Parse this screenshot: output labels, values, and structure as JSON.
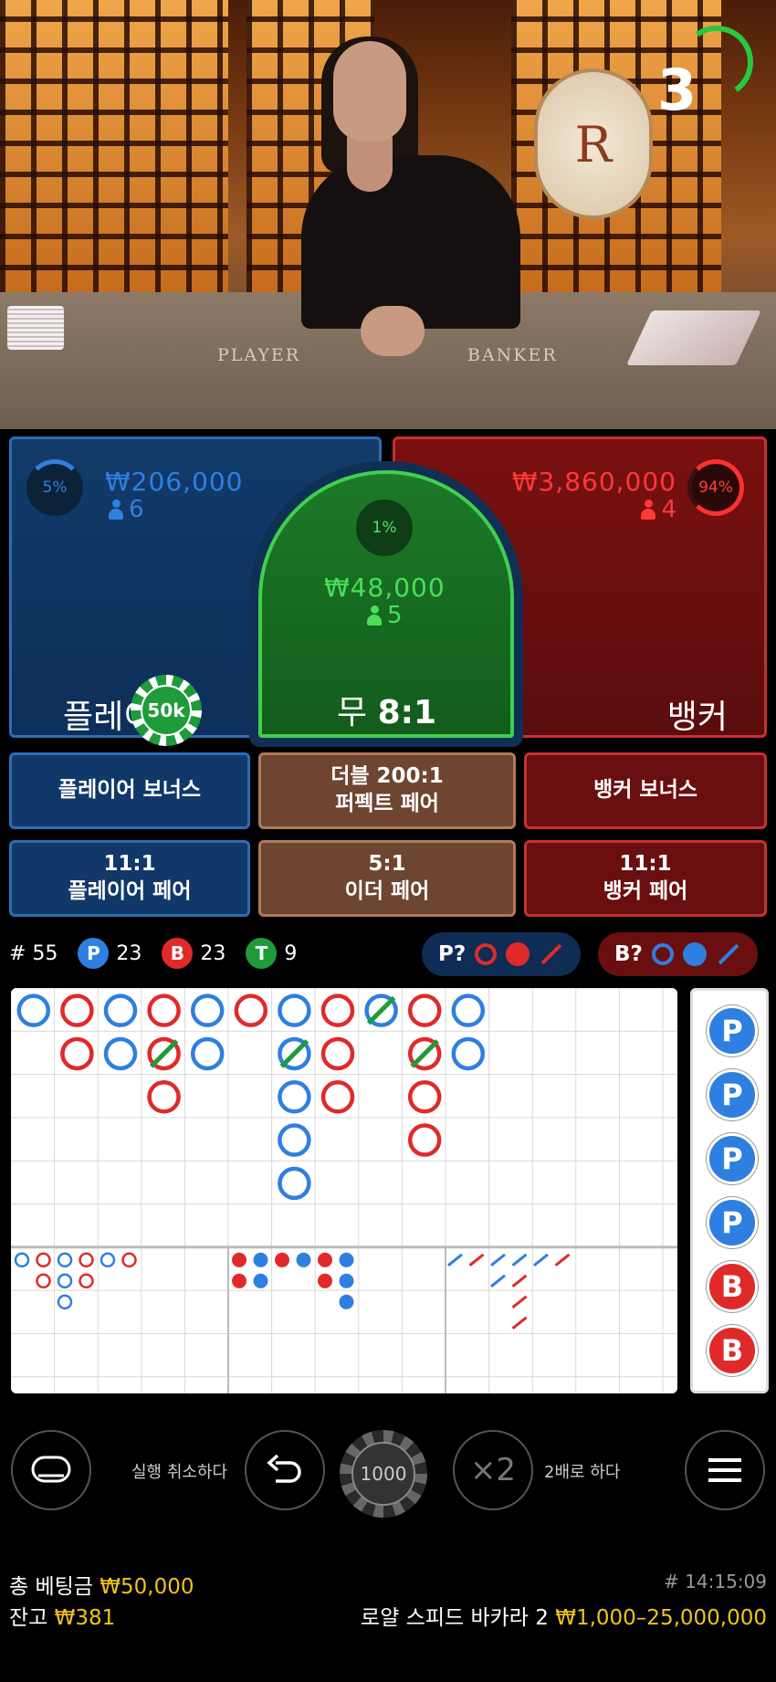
{
  "video": {
    "countdown": "3",
    "table_player_label": "PLAYER",
    "table_banker_label": "BANKER",
    "emblem_letter": "R"
  },
  "player": {
    "percent": "5%",
    "amount": "₩206,000",
    "count": "6",
    "title": "플레이어"
  },
  "tie": {
    "percent": "1%",
    "amount": "₩48,000",
    "count": "5",
    "title_prefix": "무",
    "odds": "8:1"
  },
  "banker": {
    "percent": "94%",
    "amount": "₩3,860,000",
    "count": "4",
    "title": "뱅커"
  },
  "placed_chip": "50k",
  "side_bets": [
    {
      "line1": "플레이어 보너스",
      "line2": ""
    },
    {
      "line1": "더블 200:1",
      "line2": "퍼펙트 페어"
    },
    {
      "line1": "뱅커 보너스",
      "line2": ""
    },
    {
      "line1": "11:1",
      "line2": "플레이어 페어"
    },
    {
      "line1": "5:1",
      "line2": "이더 페어"
    },
    {
      "line1": "11:1",
      "line2": "뱅커 페어"
    }
  ],
  "stats": {
    "round": "# 55",
    "p_label": "P",
    "p_count": "23",
    "b_label": "B",
    "b_count": "23",
    "t_label": "T",
    "t_count": "9",
    "p_predict": "P?",
    "b_predict": "B?"
  },
  "colors": {
    "player": "#2f7fe0",
    "banker": "#e02a2a",
    "tie": "#1f9b3a",
    "gold": "#f2c31b"
  },
  "bead_road": [
    "P",
    "P",
    "P",
    "P",
    "B",
    "B"
  ],
  "controls": {
    "undo_label": "실행 취소하다",
    "chip_value": "1000",
    "double_icon": "×2",
    "double_label": "2배로 하다",
    "icons": [
      "lobby-icon",
      "undo-icon",
      "double-icon",
      "menu-icon"
    ]
  },
  "footer": {
    "total_bet_label": "총 베팅금",
    "total_bet_value": "₩50,000",
    "balance_label": "잔고",
    "balance_value": "₩381",
    "time": "# 14:15:09",
    "table_name": "로얄 스피드 바카라 2",
    "limits": "₩1,000–25,000,000"
  }
}
